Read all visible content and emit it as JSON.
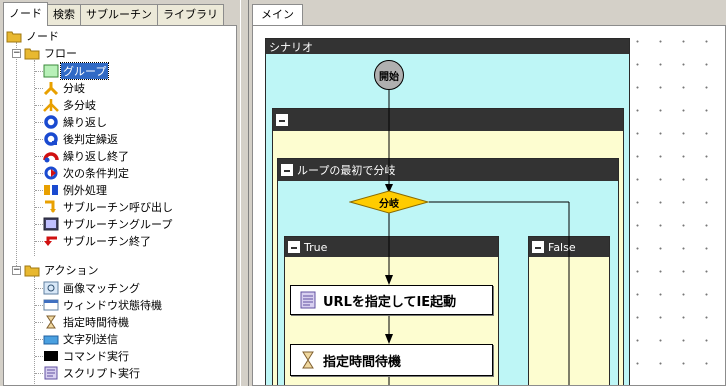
{
  "left_tabs": [
    "ノード",
    "検索",
    "サブルーチン",
    "ライブラリ"
  ],
  "tree": {
    "root": "ノード",
    "flow": {
      "label": "フロー",
      "items": [
        "グループ",
        "分岐",
        "多分岐",
        "繰り返し",
        "後判定繰返",
        "繰り返し終了",
        "次の条件判定",
        "例外処理",
        "サブルーチン呼び出し",
        "サブルーチングループ",
        "サブルーチン終了"
      ]
    },
    "action": {
      "label": "アクション",
      "items": [
        "画像マッチング",
        "ウィンドウ状態待機",
        "指定時間待機",
        "文字列送信",
        "コマンド実行",
        "スクリプト実行"
      ]
    }
  },
  "right_tabs": [
    "メイン"
  ],
  "canvas": {
    "scenario_title": "シナリオ",
    "start_label": "開始",
    "loop_title": "ループの最初で分岐",
    "branch_label": "分岐",
    "true_title": "True",
    "false_title": "False",
    "action1": "URLを指定してIE起動",
    "action2": "指定時間待機"
  }
}
